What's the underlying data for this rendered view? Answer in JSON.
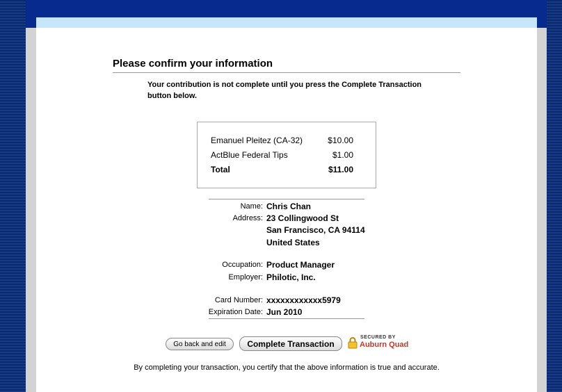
{
  "heading": "Please confirm your information",
  "notice": "Your contribution is not complete until you press the Complete Transaction button below.",
  "summary": {
    "items": [
      {
        "label": "Emanuel Pleitez (CA-32)",
        "amount": "$10.00"
      },
      {
        "label": "ActBlue Federal Tips",
        "amount": "$1.00"
      }
    ],
    "total_label": "Total",
    "total_amount": "$11.00"
  },
  "info": {
    "name_label": "Name:",
    "name": "Chris Chan",
    "address_label": "Address:",
    "address_line1": "23 Collingwood St",
    "address_line2": "San Francisco, CA 94114",
    "address_line3": "United States",
    "occupation_label": "Occupation:",
    "occupation": "Product Manager",
    "employer_label": "Employer:",
    "employer": "Philotic, Inc.",
    "card_label": "Card Number:",
    "card_number": "xxxxxxxxxxxx5979",
    "expiration_label": "Expiration Date:",
    "expiration": "Jun 2010"
  },
  "buttons": {
    "back": "Go back and edit",
    "complete": "Complete Transaction"
  },
  "secured": {
    "by": "SECURED BY",
    "name": "Auburn Quad"
  },
  "certify": "By completing your transaction, you certify that the above information is true and accurate.",
  "colors": {
    "top_bar": "#062a8e",
    "light_strip": "#c6e7fb",
    "frame": "#d3d3d3"
  }
}
